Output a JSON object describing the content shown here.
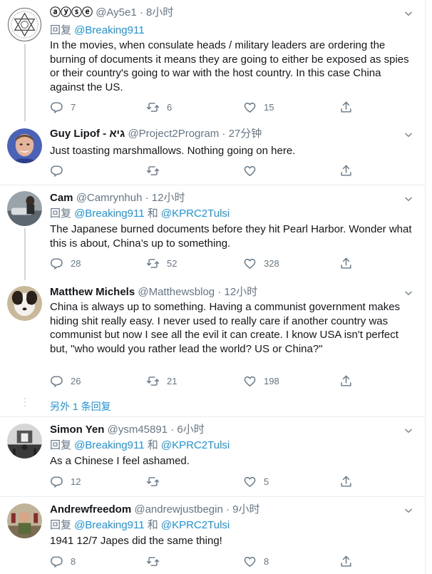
{
  "reply_prefix": "回复",
  "and_word": "和",
  "tweets": [
    {
      "name": "ⓐⓨⓢⓔ",
      "handle": "@Ay5e1",
      "time": "8小时",
      "reply_to": [
        "@Breaking911"
      ],
      "text": "In the movies, when consulate heads / military leaders are ordering the burning of documents it means they are going to either be exposed as spies or their country's going to war with the host country. In this case China against the US.",
      "replies": "7",
      "retweets": "6",
      "likes": "15"
    },
    {
      "name": "Guy Lipof - גיא",
      "handle": "@Project2Program",
      "time": "27分钟",
      "reply_to": [],
      "text": "Just toasting marshmallows. Nothing going on here.",
      "replies": "",
      "retweets": "",
      "likes": ""
    },
    {
      "name": "Cam",
      "handle": "@Camrynhuh",
      "time": "12小时",
      "reply_to": [
        "@Breaking911",
        "@KPRC2Tulsi"
      ],
      "text": "The Japanese burned documents before they hit Pearl Harbor. Wonder what this is about, China’s up to something.",
      "replies": "28",
      "retweets": "52",
      "likes": "328"
    },
    {
      "name": "Matthew Michels",
      "handle": "@Matthewsblog",
      "time": "12小时",
      "reply_to": [],
      "text": "China is always up to something. Having a communist government makes hiding shit really easy. I never used to really care if another country was communist but now I see all the evil it can create. I know USA isn't perfect but, \"who would you rather lead the world? US or China?\"",
      "replies": "26",
      "retweets": "21",
      "likes": "198",
      "more_replies": "另外 1 条回复"
    },
    {
      "name": "Simon Yen",
      "handle": "@ysm45891",
      "time": "6小时",
      "reply_to": [
        "@Breaking911",
        "@KPRC2Tulsi"
      ],
      "text": "As a Chinese I feel ashamed.",
      "replies": "12",
      "retweets": "",
      "likes": "5"
    },
    {
      "name": "Andrewfreedom",
      "handle": "@andrewjustbegin",
      "time": "9小时",
      "reply_to": [
        "@Breaking911",
        "@KPRC2Tulsi"
      ],
      "text": "1941 12/7 Japes did the same thing!",
      "replies": "8",
      "retweets": "",
      "likes": "8"
    }
  ]
}
